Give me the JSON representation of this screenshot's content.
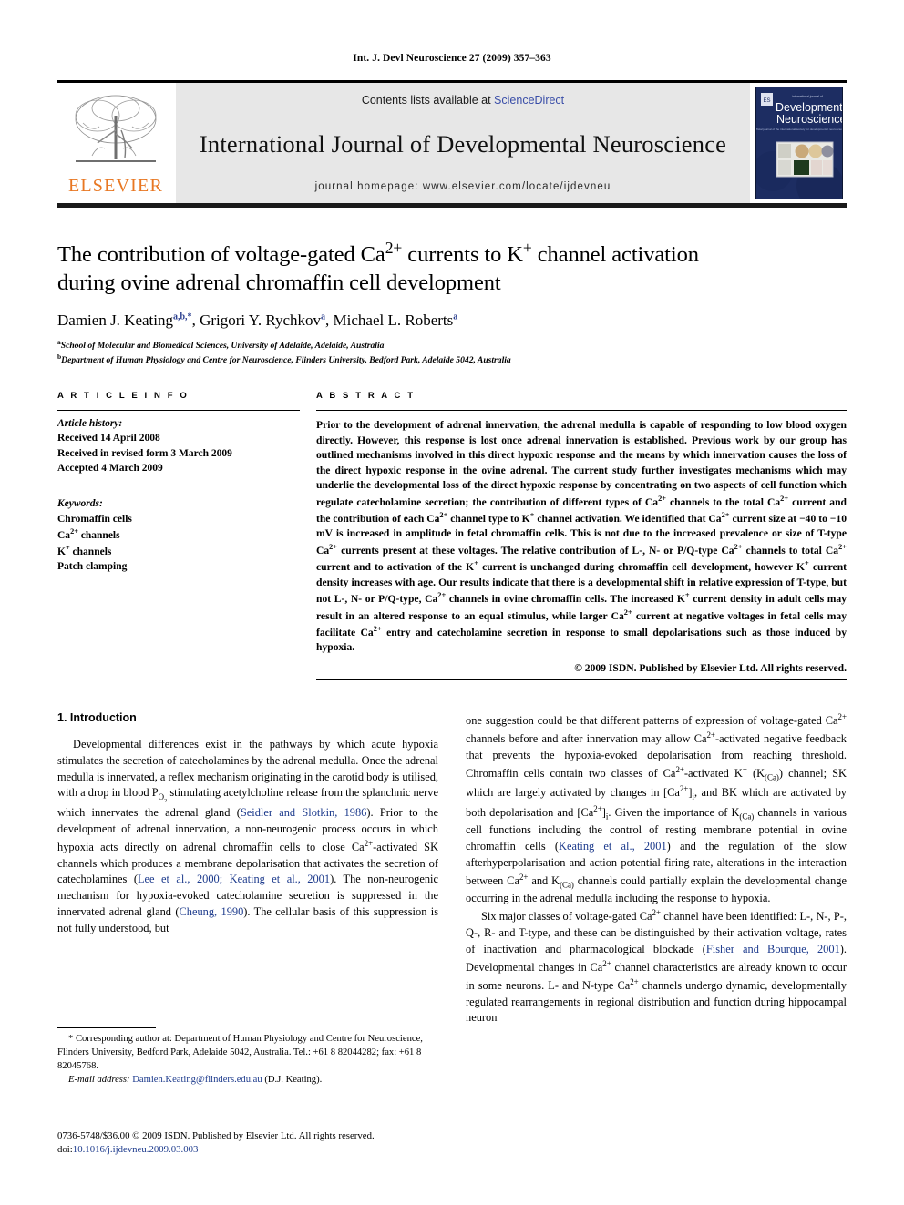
{
  "running_head": "Int. J. Devl Neuroscience 27 (2009) 357–363",
  "masthead": {
    "publisher_logo_text": "ELSEVIER",
    "contents_prefix": "Contents lists available at ",
    "contents_link": "ScienceDirect",
    "journal_name": "International Journal of Developmental Neuroscience",
    "homepage": "journal homepage: www.elsevier.com/locate/ijdevneu",
    "cover": {
      "kicker": "international journal of",
      "line1": "Developmental",
      "line2": "Neuroscience",
      "subline": "official journal of the international society for developmental neuroscience"
    }
  },
  "article": {
    "title_line1": "The contribution of voltage-gated Ca2+ currents to K+ channel activation",
    "title_line2": "during ovine adrenal chromaffin cell development",
    "authors": [
      {
        "name": "Damien J. Keating",
        "marks": "a,b,*"
      },
      {
        "name": "Grigori Y. Rychkov",
        "marks": "a"
      },
      {
        "name": "Michael L. Roberts",
        "marks": "a"
      }
    ],
    "affiliations": [
      {
        "mark": "a",
        "text": "School of Molecular and Biomedical Sciences, University of Adelaide, Adelaide, Australia"
      },
      {
        "mark": "b",
        "text": "Department of Human Physiology and Centre for Neuroscience, Flinders University, Bedford Park, Adelaide 5042, Australia"
      }
    ]
  },
  "article_info": {
    "heading": "A R T I C L E   I N F O",
    "history_label": "Article history:",
    "history": [
      "Received 14 April 2008",
      "Received in revised form 3 March 2009",
      "Accepted 4 March 2009"
    ],
    "keywords_label": "Keywords:",
    "keywords": [
      "Chromaffin cells",
      "Ca2+ channels",
      "K+ channels",
      "Patch clamping"
    ]
  },
  "abstract": {
    "heading": "A B S T R A C T",
    "text": "Prior to the development of adrenal innervation, the adrenal medulla is capable of responding to low blood oxygen directly. However, this response is lost once adrenal innervation is established. Previous work by our group has outlined mechanisms involved in this direct hypoxic response and the means by which innervation causes the loss of the direct hypoxic response in the ovine adrenal. The current study further investigates mechanisms which may underlie the developmental loss of the direct hypoxic response by concentrating on two aspects of cell function which regulate catecholamine secretion; the contribution of different types of Ca2+ channels to the total Ca2+ current and the contribution of each Ca2+ channel type to K+ channel activation. We identified that Ca2+ current size at −40 to −10 mV is increased in amplitude in fetal chromaffin cells. This is not due to the increased prevalence or size of T-type Ca2+ currents present at these voltages. The relative contribution of L-, N- or P/Q-type Ca2+ channels to total Ca2+ current and to activation of the K+ current is unchanged during chromaffin cell development, however K+ current density increases with age. Our results indicate that there is a developmental shift in relative expression of T-type, but not L-, N- or P/Q-type, Ca2+ channels in ovine chromaffin cells. The increased K+ current density in adult cells may result in an altered response to an equal stimulus, while larger Ca2+ current at negative voltages in fetal cells may facilitate Ca2+ entry and catecholamine secretion in response to small depolarisations such as those induced by hypoxia.",
    "copyright": "© 2009 ISDN. Published by Elsevier Ltd. All rights reserved."
  },
  "body": {
    "section_heading": "1. Introduction",
    "left_paragraph_1": "Developmental differences exist in the pathways by which acute hypoxia stimulates the secretion of catecholamines by the adrenal medulla. Once the adrenal medulla is innervated, a reflex mechanism originating in the carotid body is utilised, with a drop in blood PO2 stimulating acetylcholine release from the splanchnic nerve which innervates the adrenal gland (Seidler and Slotkin, 1986). Prior to the development of adrenal innervation, a non-neurogenic process occurs in which hypoxia acts directly on adrenal chromaffin cells to close Ca2+-activated SK channels which produces a membrane depolarisation that activates the secretion of catecholamines (Lee et al., 2000; Keating et al., 2001). The non-neurogenic mechanism for hypoxia-evoked catecholamine secretion is suppressed in the innervated adrenal gland (Cheung, 1990). The cellular basis of this suppression is not fully understood, but",
    "right_paragraph_1": "one suggestion could be that different patterns of expression of voltage-gated Ca2+ channels before and after innervation may allow Ca2+-activated negative feedback that prevents the hypoxia-evoked depolarisation from reaching threshold. Chromaffin cells contain two classes of Ca2+-activated K+ (K(Ca)) channel; SK which are largely activated by changes in [Ca2+]i, and BK which are activated by both depolarisation and [Ca2+]i. Given the importance of K(Ca) channels in various cell functions including the control of resting membrane potential in ovine chromaffin cells (Keating et al., 2001) and the regulation of the slow afterhyperpolarisation and action potential firing rate, alterations in the interaction between Ca2+ and K(Ca) channels could partially explain the developmental change occurring in the adrenal medulla including the response to hypoxia.",
    "right_paragraph_2": "Six major classes of voltage-gated Ca2+ channel have been identified: L-, N-, P-, Q-, R- and T-type, and these can be distinguished by their activation voltage, rates of inactivation and pharmacological blockade (Fisher and Bourque, 2001). Developmental changes in Ca2+ channel characteristics are already known to occur in some neurons. L- and N-type Ca2+ channels undergo dynamic, developmentally regulated rearrangements in regional distribution and function during hippocampal neuron",
    "references_inline": [
      "Seidler and Slotkin, 1986",
      "Lee et al., 2000",
      "Keating et al., 2001",
      "Cheung, 1990",
      "Fisher and Bourque, 2001"
    ]
  },
  "footnotes": {
    "corresponding": "* Corresponding author at: Department of Human Physiology and Centre for Neuroscience, Flinders University, Bedford Park, Adelaide 5042, Australia. Tel.: +61 8 82044282; fax: +61 8 82045768.",
    "email_label": "E-mail address:",
    "email": "Damien.Keating@flinders.edu.au",
    "email_suffix": "(D.J. Keating)."
  },
  "footer": {
    "issn_line": "0736-5748/$36.00 © 2009 ISDN. Published by Elsevier Ltd. All rights reserved.",
    "doi_prefix": "doi:",
    "doi": "10.1016/j.ijdevneu.2009.03.003"
  },
  "colors": {
    "link": "#1c3a8c",
    "elsevier_orange": "#E87722",
    "sciencedirect_blue": "#3a4ea8",
    "band_gray": "#e7e7e7",
    "cover_navy": "#1b2a5e"
  }
}
